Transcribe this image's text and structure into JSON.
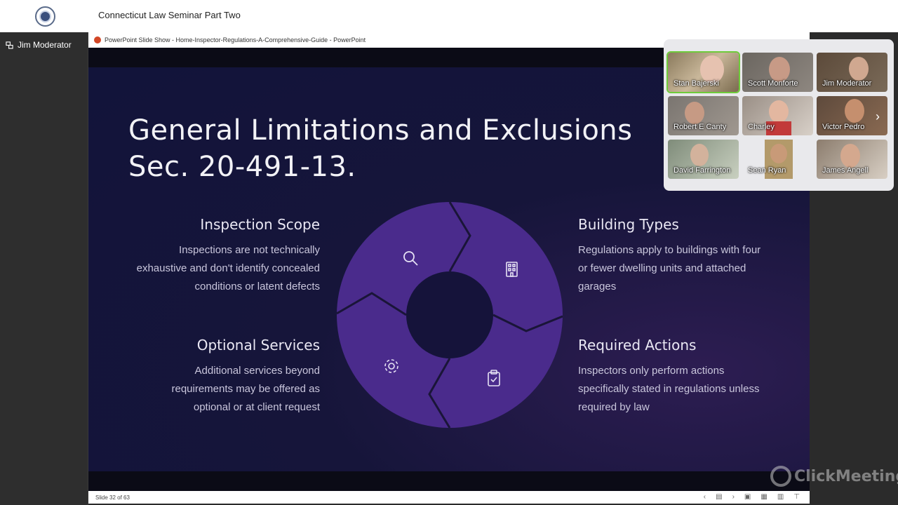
{
  "app": {
    "title": "Connecticut Law Seminar Part Two",
    "presenter": "Jim Moderator"
  },
  "ppt": {
    "window_title": "PowerPoint Slide Show  -  Home-Inspector-Regulations-A-Comprehensive-Guide  -  PowerPoint",
    "slide_status": "Slide 32 of 63"
  },
  "slide": {
    "heading_line1": "General Limitations and Exclusions",
    "heading_line2": "Sec. 20-491-13.",
    "blocks": [
      {
        "title": "Inspection Scope",
        "lines": [
          "Inspections are not technically",
          "exhaustive and don't identify concealed",
          "conditions or latent defects"
        ]
      },
      {
        "title": "Building Types",
        "lines": [
          "Regulations apply to buildings with four",
          "or fewer dwelling units and attached",
          "garages"
        ]
      },
      {
        "title": "Optional Services",
        "lines": [
          "Additional services beyond",
          "requirements may be offered as",
          "optional or at client request"
        ]
      },
      {
        "title": "Required Actions",
        "lines": [
          "Inspectors only perform actions",
          "specifically stated in regulations unless",
          "required by law"
        ]
      }
    ]
  },
  "participants": [
    {
      "name": "Stan Bajerski",
      "bg": "#8a7a5c"
    },
    {
      "name": "Scott Monforte",
      "bg": "#6b6660"
    },
    {
      "name": "Jim Moderator",
      "bg": "#5c4a3a"
    },
    {
      "name": "Robert E Canty",
      "bg": "#7a7570"
    },
    {
      "name": "Charley",
      "bg": "#9a8f86"
    },
    {
      "name": "Victor Pedro",
      "bg": "#5e4a3c"
    },
    {
      "name": "David Farrington",
      "bg": "#7f8c7a"
    },
    {
      "name": "Sean Ryan",
      "bg": "#b39a6a"
    },
    {
      "name": "James Angell",
      "bg": "#8c7d6e"
    }
  ],
  "watermark": "ClickMeeting",
  "colors": {
    "slide_bg": "#16153a",
    "ring": "#4a2b8c",
    "active_speaker": "#6ecb3a"
  }
}
